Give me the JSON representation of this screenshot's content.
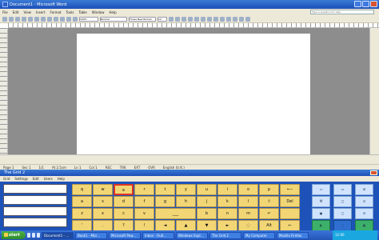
{
  "word": {
    "title": "Document1 - Microsoft Word",
    "menu": [
      "File",
      "Edit",
      "View",
      "Insert",
      "Format",
      "Tools",
      "Table",
      "Window",
      "Help"
    ],
    "help_placeholder": "Type a question for help",
    "toolbar": {
      "zoom": "100%",
      "style": "Normal",
      "font": "Times New Roman",
      "size": "12"
    },
    "status": [
      "Page 1",
      "Sec 1",
      "1/1",
      "At 2.5cm",
      "Ln 1",
      "Col 1",
      "REC",
      "TRK",
      "EXT",
      "OVR",
      "English (U.K.)"
    ]
  },
  "keyboard": {
    "title": "The Grid 2",
    "menu": [
      "Grid",
      "Settings",
      "Edit",
      "Users",
      "Help"
    ],
    "rows": [
      [
        "q",
        "w",
        "e",
        "r",
        "t",
        "y",
        "u",
        "i",
        "o",
        "p",
        "⟵"
      ],
      [
        "a",
        "s",
        "d",
        "f",
        "g",
        "h",
        "j",
        "k",
        "l",
        "⇧",
        "Del"
      ],
      [
        "z",
        "x",
        "c",
        "v",
        "",
        "",
        "b",
        "n",
        "m",
        "↵",
        ""
      ],
      [
        "'",
        ".",
        "?",
        "!",
        "◄",
        "▲",
        "▼",
        "►",
        "◌",
        "Alt",
        "⇐"
      ]
    ],
    "space_label": "___",
    "fkeys": [
      [
        "⇦",
        "▭",
        "⊞"
      ],
      [
        "M",
        "□",
        "⊡"
      ],
      [
        "▣",
        "▢",
        "⊟"
      ],
      [
        "◐",
        "◌",
        "▦"
      ]
    ]
  },
  "taskbar": {
    "start": "start",
    "tasks": [
      "Document1 - ...",
      "Book1 - Micr...",
      "Microsoft Pow...",
      "Inbox - Outl...",
      "Windows Expl...",
      "The Grid 2",
      "My Computer",
      "Mozilla Firefox"
    ],
    "clock": "12:00"
  }
}
